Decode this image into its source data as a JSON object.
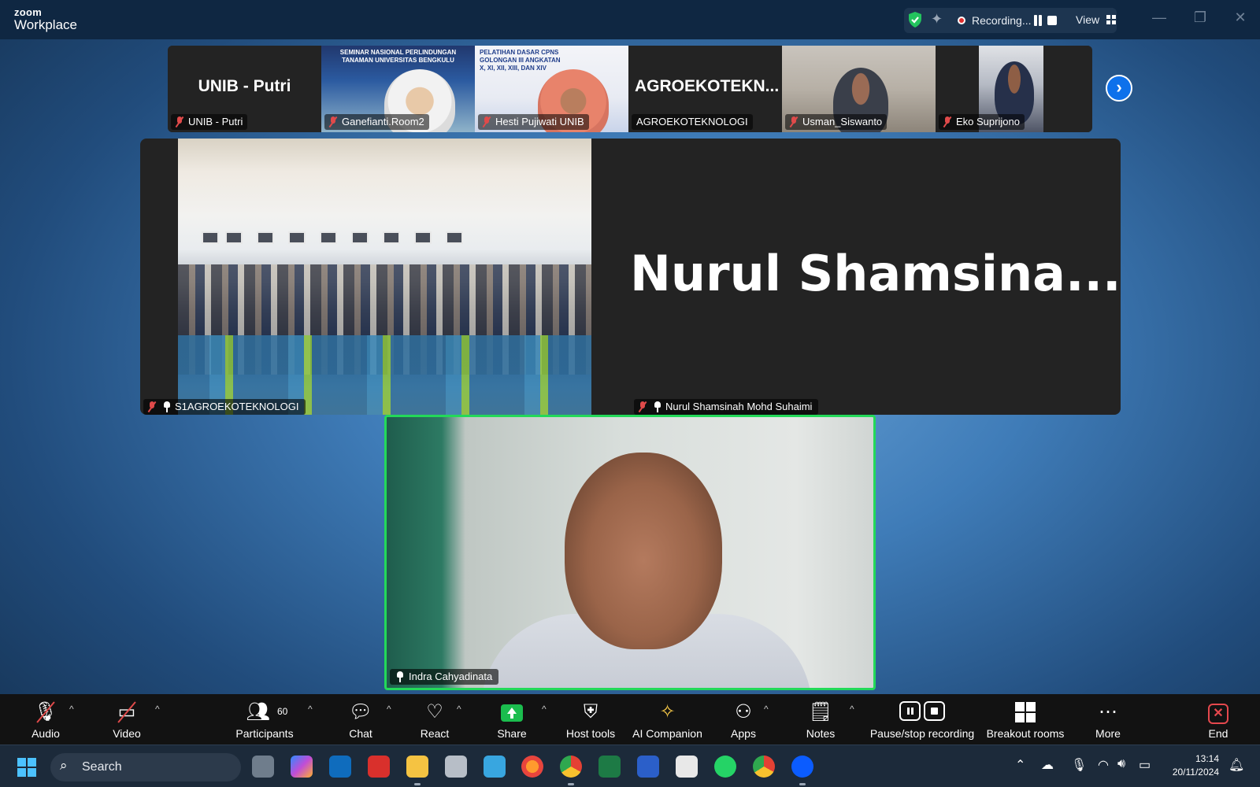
{
  "titlebar": {
    "brand_top": "zoom",
    "brand_bottom": "Workplace",
    "recording_label": "Recording...",
    "view_label": "View"
  },
  "thumbnails": [
    {
      "display_text": "UNIB - Putri",
      "name": "UNIB - Putri",
      "muted": true,
      "video": false
    },
    {
      "display_text": "",
      "name": "Ganefianti.Room2",
      "muted": true,
      "video": true,
      "banner": "SEMINAR NASIONAL PERLINDUNGAN TANAMAN UNIVERSITAS BENGKULU"
    },
    {
      "display_text": "",
      "name": "Hesti Pujiwati UNIB",
      "muted": true,
      "video": true,
      "banner": "PELATIHAN DASAR CPNS GOLONGAN III ANGKATAN X, XI, XII, XIII, DAN XIV"
    },
    {
      "display_text": "AGROEKOTEKN...",
      "name": "AGROEKOTEKNOLOGI",
      "muted": false,
      "video": false
    },
    {
      "display_text": "",
      "name": "Usman_Siswanto",
      "muted": true,
      "video": true
    },
    {
      "display_text": "",
      "name": "Eko Suprijono",
      "muted": true,
      "video": true
    }
  ],
  "main": {
    "left_tile_name": "S1AGROEKOTEKNOLOGI",
    "right_tile_big": "Nurul Shamsina...",
    "right_tile_name": "Nurul Shamsinah Mohd Suhaimi",
    "speaker_name": "Indra Cahyadinata"
  },
  "toolbar": {
    "audio": "Audio",
    "video": "Video",
    "participants": "Participants",
    "participants_count": "60",
    "chat": "Chat",
    "react": "React",
    "share": "Share",
    "host_tools": "Host tools",
    "ai_companion": "AI Companion",
    "apps": "Apps",
    "notes": "Notes",
    "pause_stop": "Pause/stop recording",
    "breakout": "Breakout rooms",
    "more": "More",
    "end": "End"
  },
  "taskbar": {
    "search_label": "Search",
    "time": "13:14",
    "date": "20/11/2024"
  },
  "colors": {
    "accent_blue": "#0e71eb",
    "active_speaker": "#23d959",
    "share_green": "#1bbd4e",
    "end_red": "#e5484d",
    "muted_red": "#e04a4a"
  }
}
